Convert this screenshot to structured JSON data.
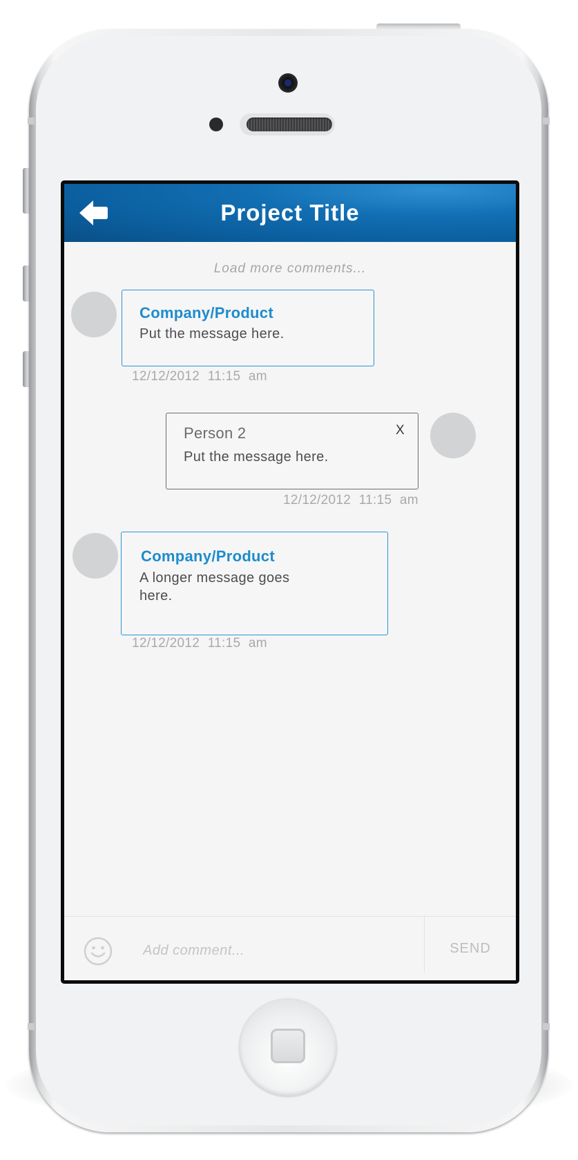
{
  "header": {
    "title": "Project Title",
    "back_icon": "back-arrow-icon"
  },
  "thread": {
    "load_more_label": "Load more comments...",
    "messages": [
      {
        "side": "left",
        "sender": "Company/Product",
        "text": "Put the message here.",
        "date": "12/12/2012",
        "time": "11:15 am",
        "accent": "#1d8ccd"
      },
      {
        "side": "right",
        "sender": "Person 2",
        "text": "Put the message here.",
        "close_label": "X",
        "date": "12/12/2012",
        "time": "11:15 am",
        "accent": "#6b6b6d"
      },
      {
        "side": "left",
        "sender": "Company/Product",
        "text": "A longer message goes here.",
        "date": "12/12/2012",
        "time": "11:15 am",
        "accent": "#1d8ccd"
      }
    ]
  },
  "composer": {
    "emoji_icon": "smiley-icon",
    "placeholder": "Add comment...",
    "value": "",
    "send_label": "SEND"
  },
  "theme": {
    "header_color": "#0b5f9f",
    "accent": "#1d8ccd",
    "avatar_color": "#d2d3d4"
  }
}
